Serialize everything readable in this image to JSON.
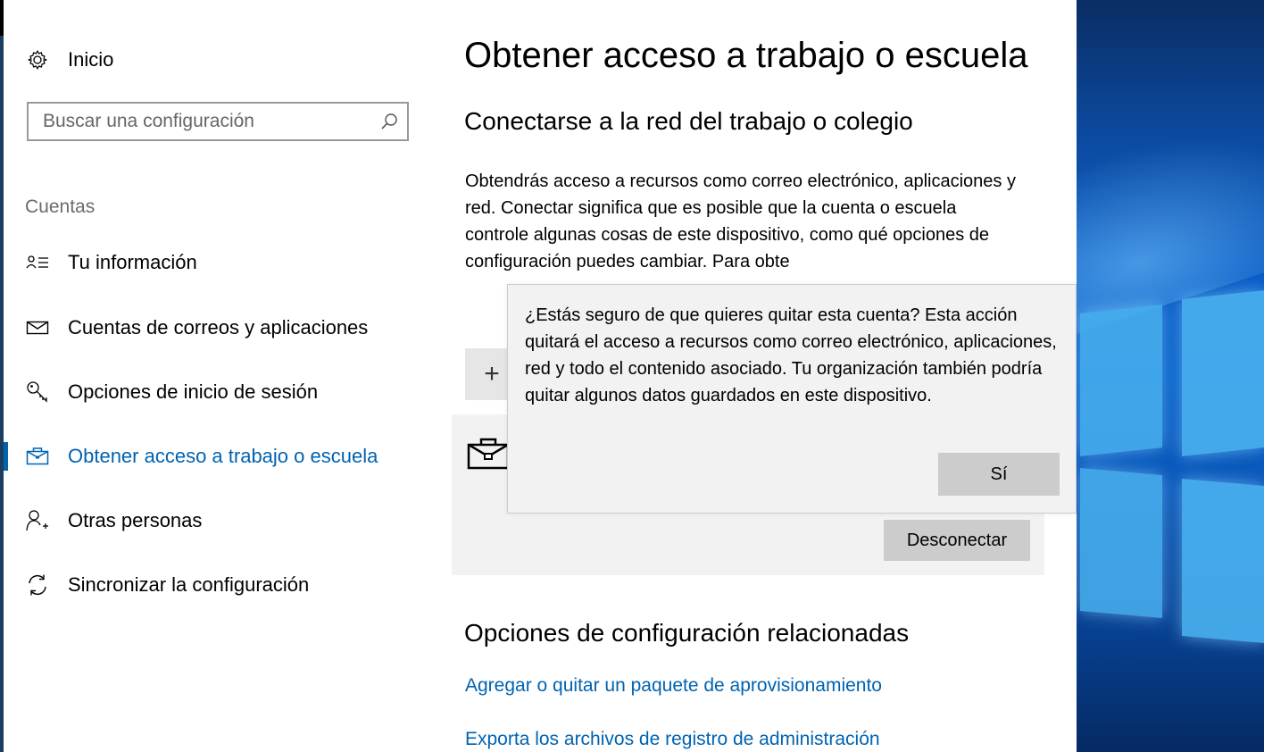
{
  "sidebar": {
    "home_label": "Inicio",
    "search_placeholder": "Buscar una configuración",
    "section_label": "Cuentas",
    "items": [
      {
        "label": "Tu información",
        "icon": "user-info-icon",
        "active": false
      },
      {
        "label": "Cuentas de correos y aplicaciones",
        "icon": "mail-icon",
        "active": false
      },
      {
        "label": "Opciones de inicio de sesión",
        "icon": "key-icon",
        "active": false
      },
      {
        "label": "Obtener acceso a trabajo o escuela",
        "icon": "briefcase-icon",
        "active": true
      },
      {
        "label": "Otras personas",
        "icon": "add-person-icon",
        "active": false
      },
      {
        "label": "Sincronizar la configuración",
        "icon": "sync-icon",
        "active": false
      }
    ]
  },
  "main": {
    "title": "Obtener acceso a trabajo o escuela",
    "subtitle": "Conectarse a la red del trabajo o colegio",
    "description": "Obtendrás acceso a recursos como correo electrónico, aplicaciones y red. Conectar significa que es posible que la cuenta o escuela controle algunas cosas de este dispositivo, como qué opciones de configuración puedes cambiar. Para obte",
    "connect_symbol": "+",
    "disconnect_label": "Desconectar",
    "related_title": "Opciones de configuración relacionadas",
    "links": [
      "Agregar o quitar un paquete de aprovisionamiento",
      "Exporta los archivos de registro de administración"
    ]
  },
  "dialog": {
    "message": "¿Estás seguro de que quieres quitar esta cuenta? Esta acción quitará el acceso a recursos como correo electrónico, aplicaciones, red y todo el contenido asociado. Tu organización también podría quitar algunos datos guardados en este dispositivo.",
    "yes_label": "Sí"
  },
  "colors": {
    "accent": "#0063b1",
    "dialog_bg": "#f2f2f2",
    "button_bg": "#cccccc",
    "panel_bg": "#f2f2f2"
  }
}
